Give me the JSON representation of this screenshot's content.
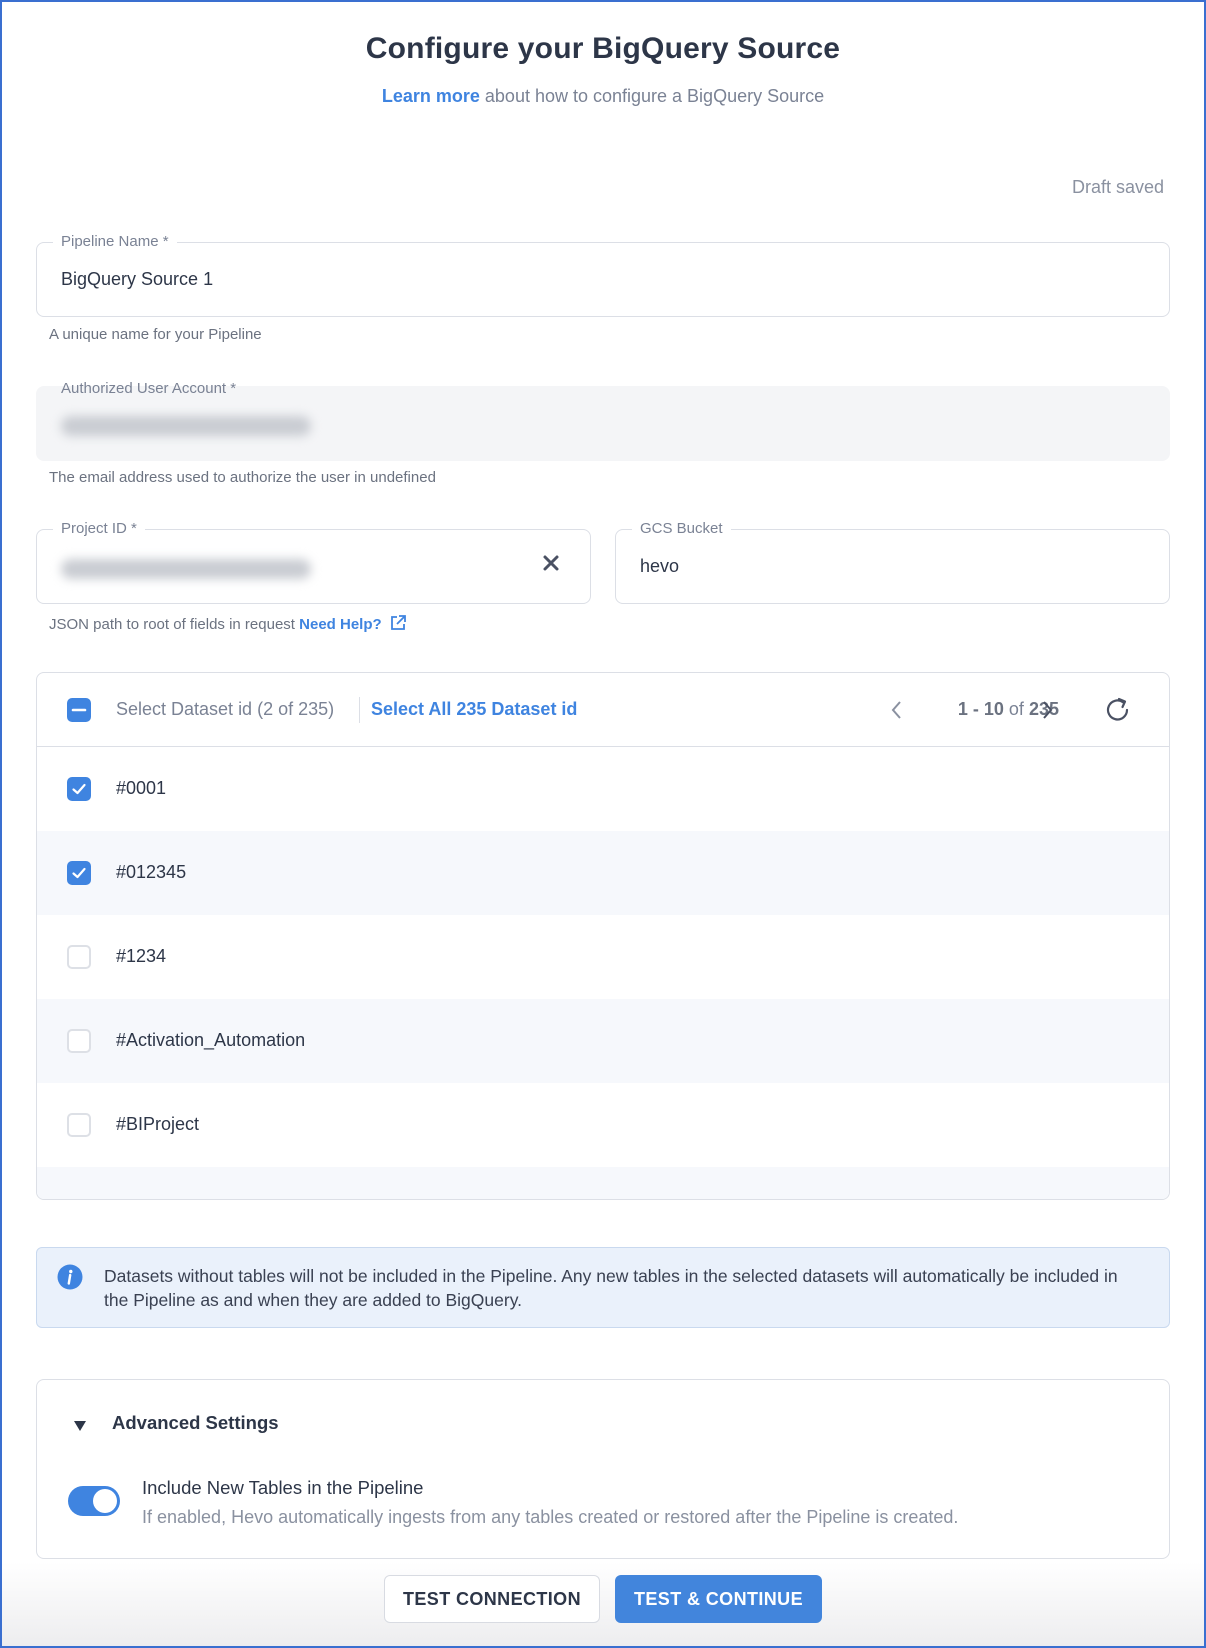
{
  "header": {
    "title": "Configure your BigQuery Source",
    "learn_more": "Learn more",
    "subtitle_rest": " about how to configure a BigQuery Source"
  },
  "status": {
    "draft": "Draft saved"
  },
  "pipeline_name": {
    "label": "Pipeline Name *",
    "value": "BigQuery Source 1",
    "hint": "A unique name for your Pipeline"
  },
  "authorized_account": {
    "label": "Authorized User Account *",
    "value_redacted": true,
    "hint": "The email address used to authorize the user in undefined"
  },
  "project_id": {
    "label": "Project ID *",
    "value_redacted": true,
    "hint": "JSON path to root of fields in request ",
    "help_link": "Need Help?"
  },
  "gcs_bucket": {
    "label": "GCS Bucket",
    "value": "hevo"
  },
  "datasets": {
    "select_label": "Select Dataset id (2 of 235)",
    "select_all": "Select All 235 Dataset id",
    "pager": {
      "range": "1 - 10",
      "of": "of",
      "total": "235"
    },
    "header_state": "indeterminate",
    "rows": [
      {
        "name": "#0001",
        "checked": true
      },
      {
        "name": "#012345",
        "checked": true
      },
      {
        "name": "#1234",
        "checked": false
      },
      {
        "name": "#Activation_Automation",
        "checked": false
      },
      {
        "name": "#BIProject",
        "checked": false
      }
    ]
  },
  "info": {
    "text": "Datasets without tables will not be included in the Pipeline. Any new tables in the selected datasets will automatically be included in the Pipeline as and when they are added to BigQuery."
  },
  "advanced": {
    "title": "Advanced Settings",
    "expanded": true,
    "option_title": "Include New Tables in the Pipeline",
    "option_desc": "If enabled, Hevo automatically ingests from any tables created or restored after the Pipeline is created.",
    "option_enabled": true
  },
  "actions": {
    "test_connection": "TEST CONNECTION",
    "test_continue": "TEST & CONTINUE"
  },
  "colors": {
    "accent": "#3f84e0",
    "text": "#2d3648",
    "muted": "#7a8294",
    "info_bg": "#eaf1fb"
  }
}
